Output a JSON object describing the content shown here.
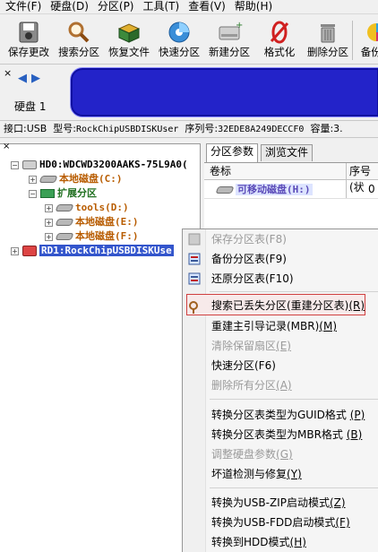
{
  "menubar": {
    "items": [
      "文件(F)",
      "硬盘(D)",
      "分区(P)",
      "工具(T)",
      "查看(V)",
      "帮助(H)"
    ]
  },
  "toolbar": {
    "buttons": [
      {
        "label": "保存更改",
        "icon": "save-icon"
      },
      {
        "label": "搜索分区",
        "icon": "magnifier-icon"
      },
      {
        "label": "恢复文件",
        "icon": "box-icon"
      },
      {
        "label": "快速分区",
        "icon": "disc-icon"
      },
      {
        "label": "新建分区",
        "icon": "new-disk-icon"
      },
      {
        "label": "格式化",
        "icon": "format-icon"
      },
      {
        "label": "删除分区",
        "icon": "trash-icon"
      },
      {
        "label": "备份分",
        "icon": "backup-icon"
      }
    ]
  },
  "diskbar": {
    "close": "×",
    "label": "硬盘 1",
    "band_color": "#2323c9"
  },
  "infobar": {
    "interface": "接口:USB",
    "model_label": "型号:",
    "model_value": "RockChipUSBDISKUser",
    "serial_label": "序列号:",
    "serial_value": "32EDE8A249DECCF0",
    "capacity": "容量:3."
  },
  "tree": {
    "close": "×",
    "nodes": [
      {
        "label": "HD0:WDCWD3200AAKS-75L9A0(",
        "expander": "−"
      },
      {
        "label": "本地磁盘(C:)",
        "expander": "+"
      },
      {
        "label": "扩展分区",
        "expander": "−"
      },
      {
        "label": "tools(D:)",
        "expander": "+"
      },
      {
        "label": "本地磁盘(E:)",
        "expander": "+"
      },
      {
        "label": "本地磁盘(F:)",
        "expander": "+"
      },
      {
        "label": "RD1:RockChipUSBDISKUse",
        "expander": "+"
      }
    ]
  },
  "tabs": [
    "分区参数",
    "浏览文件"
  ],
  "grid": {
    "headers": [
      "卷标",
      "序号(状"
    ],
    "rows": [
      {
        "name": "可移动磁盘(H:)",
        "index": "0"
      }
    ]
  },
  "context_menu": {
    "items": [
      {
        "label": "保存分区表(F8)",
        "disabled": true,
        "key": ""
      },
      {
        "label": "备份分区表(F9)",
        "disabled": false,
        "key": ""
      },
      {
        "label": "还原分区表(F10)",
        "disabled": false,
        "key": ""
      },
      {
        "label": "搜索已丢失分区(重建分区表)",
        "disabled": false,
        "key": "(R)"
      },
      {
        "label": "重建主引导记录(MBR)",
        "disabled": false,
        "key": "(M)"
      },
      {
        "label": "清除保留扇区",
        "disabled": true,
        "key": "(E)"
      },
      {
        "label": "快速分区(F6)",
        "disabled": false,
        "key": ""
      },
      {
        "label": "删除所有分区",
        "disabled": true,
        "key": "(A)"
      },
      {
        "label": "转换分区表类型为GUID格式 ",
        "disabled": false,
        "key": "(P)"
      },
      {
        "label": "转换分区表类型为MBR格式 ",
        "disabled": false,
        "key": "(B)"
      },
      {
        "label": "调整硬盘参数",
        "disabled": true,
        "key": "(G)"
      },
      {
        "label": "坏道检测与修复",
        "disabled": false,
        "key": "(Y)"
      },
      {
        "label": "转换为USB-ZIP启动模式",
        "disabled": false,
        "key": "(Z)"
      },
      {
        "label": "转换为USB-FDD启动模式",
        "disabled": false,
        "key": "(F)"
      },
      {
        "label": "转换到HDD模式",
        "disabled": false,
        "key": "(H)"
      }
    ]
  }
}
